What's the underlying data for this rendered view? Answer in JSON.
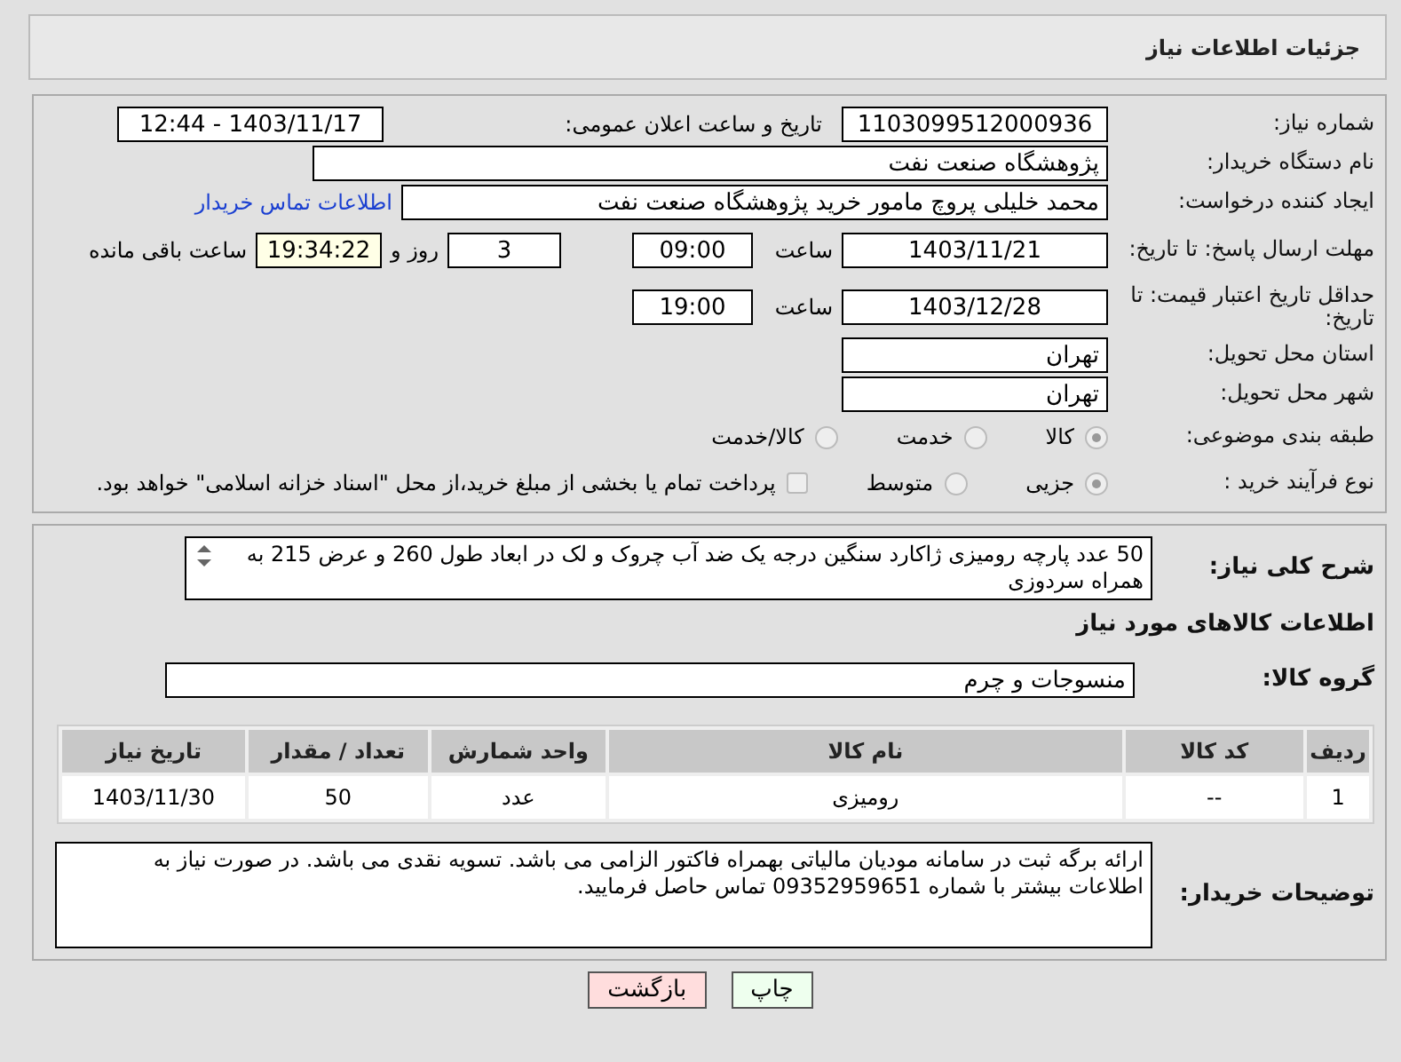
{
  "header": {
    "title": "جزئیات اطلاعات نیاز"
  },
  "need_number": {
    "label": "شماره نیاز:",
    "value": "1103099512000936"
  },
  "announce": {
    "label": "تاریخ و ساعت اعلان عمومی:",
    "value": "1403/11/17 - 12:44"
  },
  "buyer_org": {
    "label": "نام دستگاه خریدار:",
    "value": "پژوهشگاه صنعت نفت"
  },
  "requester": {
    "label": "ایجاد کننده درخواست:",
    "value": "محمد خلیلی پروچ مامور خرید پژوهشگاه صنعت نفت",
    "link": "اطلاعات تماس خریدار"
  },
  "reply_deadline": {
    "label": "مهلت ارسال پاسخ: تا تاریخ:",
    "date": "1403/11/21",
    "time_label": "ساعت",
    "time": "09:00",
    "days": "3",
    "days_label": "روز و",
    "remaining": "19:34:22",
    "remaining_label": "ساعت باقی مانده"
  },
  "price_validity": {
    "label": "حداقل تاریخ اعتبار قیمت: تا تاریخ:",
    "date": "1403/12/28",
    "time_label": "ساعت",
    "time": "19:00"
  },
  "province": {
    "label": "استان محل تحویل:",
    "value": "تهران"
  },
  "city": {
    "label": "شهر محل تحویل:",
    "value": "تهران"
  },
  "category": {
    "label": "طبقه بندی موضوعی:",
    "options": [
      {
        "label": "کالا",
        "selected": true
      },
      {
        "label": "خدمت",
        "selected": false
      },
      {
        "label": "کالا/خدمت",
        "selected": false
      }
    ]
  },
  "process": {
    "label": "نوع فرآیند خرید :",
    "options": [
      {
        "label": "جزیی",
        "selected": true
      },
      {
        "label": "متوسط",
        "selected": false
      }
    ],
    "treasury": {
      "label": "پرداخت تمام یا بخشی از مبلغ خرید،از محل \"اسناد خزانه اسلامی\" خواهد بود.",
      "checked": false
    }
  },
  "description": {
    "label": "شرح کلی نیاز:",
    "value": "50 عدد پارچه رومیزی ژاکارد سنگین درجه یک ضد آب چروک و لک در ابعاد طول 260 و عرض 215 به همراه سردوزی"
  },
  "goods_title": "اطلاعات کالاهای مورد نیاز",
  "goods_group": {
    "label": "گروه کالا:",
    "value": "منسوجات و چرم"
  },
  "table": {
    "columns": [
      "ردیف",
      "کد کالا",
      "نام کالا",
      "واحد شمارش",
      "تعداد / مقدار",
      "تاریخ نیاز"
    ],
    "rows": [
      [
        "1",
        "--",
        "رومیزی",
        "عدد",
        "50",
        "1403/11/30"
      ]
    ]
  },
  "buyer_notes": {
    "label": "توضیحات خریدار:",
    "value": "ارائه برگه ثبت در سامانه مودیان مالیاتی بهمراه فاکتور الزامی می باشد. تسویه نقدی می باشد. در صورت نیاز به اطلاعات بیشتر با شماره 09352959651 تماس حاصل فرمایید."
  },
  "buttons": [
    {
      "label": "چاپ",
      "kind": "print"
    },
    {
      "label": "بازگشت",
      "kind": "back"
    }
  ]
}
